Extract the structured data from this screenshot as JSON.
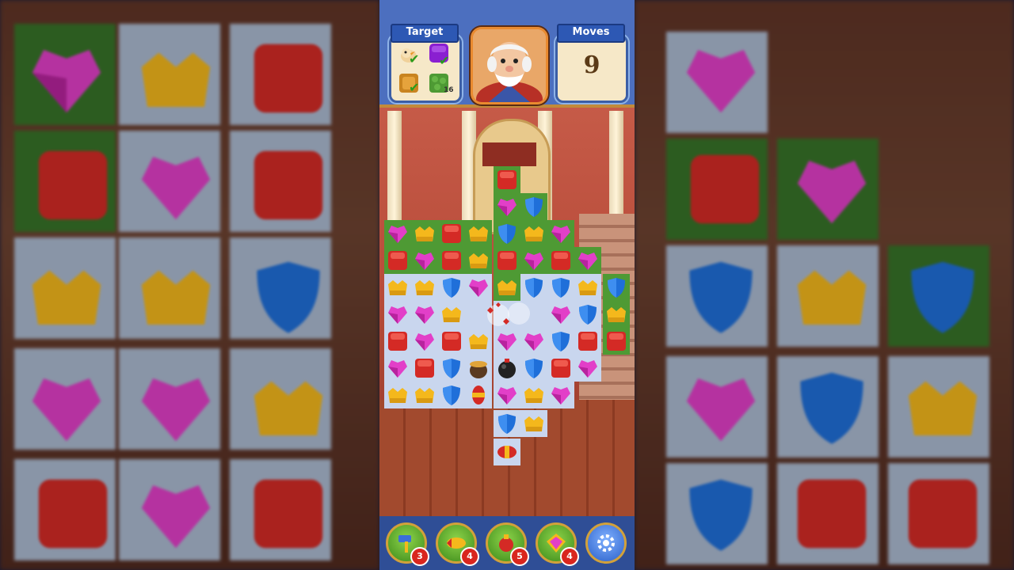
{
  "header": {
    "target_label": "Target",
    "moves_label": "Moves",
    "moves_value": "9",
    "target_count": "16"
  },
  "boosters": [
    {
      "name": "hammer",
      "count": "3"
    },
    {
      "name": "rocket",
      "count": "4"
    },
    {
      "name": "bomb",
      "count": "5"
    },
    {
      "name": "gem",
      "count": "4"
    }
  ],
  "settings_icon": "gear-icon",
  "colors": {
    "red": "#d42a25",
    "pink": "#e23fc8",
    "blue": "#1f6fd9",
    "yellow": "#f4b81c",
    "grass": "#4e9a34",
    "cell": "#c9d6ee"
  }
}
